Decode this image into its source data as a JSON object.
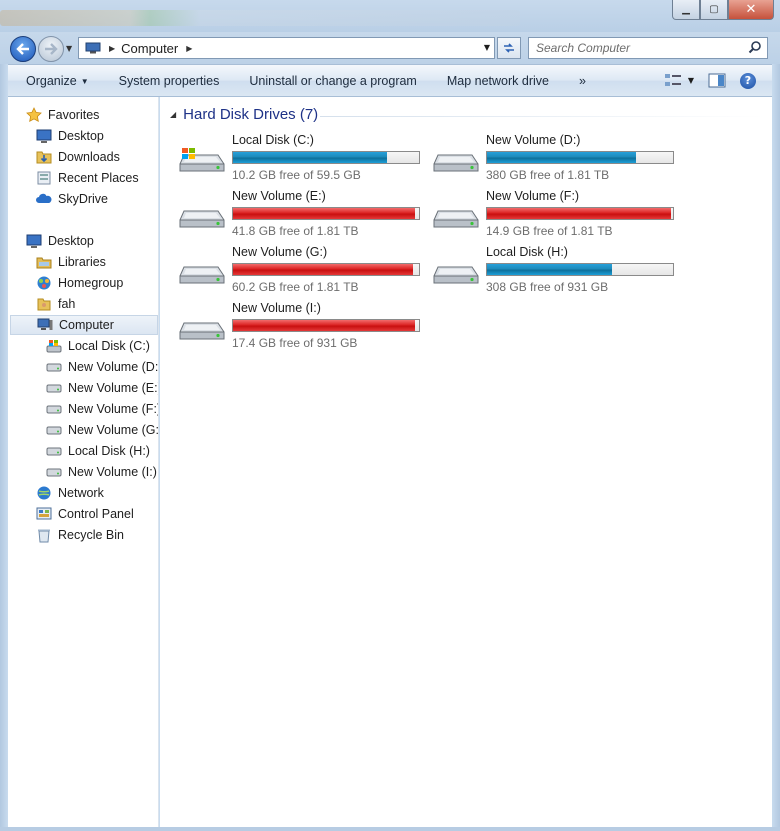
{
  "window": {
    "minimize_glyph": "▁",
    "maximize_glyph": "▢",
    "close_glyph": "✕"
  },
  "address": {
    "crumbs": [
      "Computer"
    ],
    "search_placeholder": "Search Computer"
  },
  "toolbar": {
    "organize": "Organize",
    "system_properties": "System properties",
    "uninstall": "Uninstall or change a program",
    "map_drive": "Map network drive",
    "more": "»"
  },
  "sidebar": {
    "items": [
      {
        "label": "Favorites",
        "icon": "star-icon"
      },
      {
        "label": "Desktop",
        "icon": "desktop-icon"
      },
      {
        "label": "Downloads",
        "icon": "downloads-folder-icon"
      },
      {
        "label": "Recent Places",
        "icon": "recent-places-icon"
      },
      {
        "label": "SkyDrive",
        "icon": "skydrive-icon"
      },
      {
        "label": "Desktop",
        "icon": "desktop-icon"
      },
      {
        "label": "Libraries",
        "icon": "libraries-icon"
      },
      {
        "label": "Homegroup",
        "icon": "homegroup-icon"
      },
      {
        "label": "fah",
        "icon": "user-folder-icon"
      },
      {
        "label": "Computer",
        "icon": "computer-icon"
      },
      {
        "label": "Local Disk (C:)",
        "icon": "system-drive-icon"
      },
      {
        "label": "New Volume (D:)",
        "icon": "drive-icon"
      },
      {
        "label": "New Volume (E:)",
        "icon": "drive-icon"
      },
      {
        "label": "New Volume (F:)",
        "icon": "drive-icon"
      },
      {
        "label": "New Volume (G:)",
        "icon": "drive-icon"
      },
      {
        "label": "Local Disk (H:)",
        "icon": "drive-icon"
      },
      {
        "label": "New Volume (I:)",
        "icon": "drive-icon"
      },
      {
        "label": "Network",
        "icon": "network-icon"
      },
      {
        "label": "Control Panel",
        "icon": "control-panel-icon"
      },
      {
        "label": "Recycle Bin",
        "icon": "recycle-bin-icon"
      }
    ],
    "selected": "Computer"
  },
  "content": {
    "group_title": "Hard Disk Drives (7)",
    "drives": [
      {
        "name": "Local Disk (C:)",
        "free_text": "10.2 GB free of 59.5 GB",
        "used_fraction": 0.83,
        "status": "normal",
        "system": true
      },
      {
        "name": "New Volume (D:)",
        "free_text": "380 GB free of 1.81 TB",
        "used_fraction": 0.8,
        "status": "normal",
        "system": false
      },
      {
        "name": "New Volume (E:)",
        "free_text": "41.8 GB free of 1.81 TB",
        "used_fraction": 0.98,
        "status": "critical",
        "system": false
      },
      {
        "name": "New Volume (F:)",
        "free_text": "14.9 GB free of 1.81 TB",
        "used_fraction": 0.99,
        "status": "critical",
        "system": false
      },
      {
        "name": "New Volume (G:)",
        "free_text": "60.2 GB free of 1.81 TB",
        "used_fraction": 0.97,
        "status": "critical",
        "system": false
      },
      {
        "name": "Local Disk (H:)",
        "free_text": "308 GB free of 931 GB",
        "used_fraction": 0.67,
        "status": "normal",
        "system": false
      },
      {
        "name": "New Volume (I:)",
        "free_text": "17.4 GB free of 931 GB",
        "used_fraction": 0.98,
        "status": "critical",
        "system": false
      }
    ]
  },
  "colors": {
    "group_title": "#1e3287",
    "bar_normal": "#1d8ab9",
    "bar_critical": "#dc2424"
  }
}
